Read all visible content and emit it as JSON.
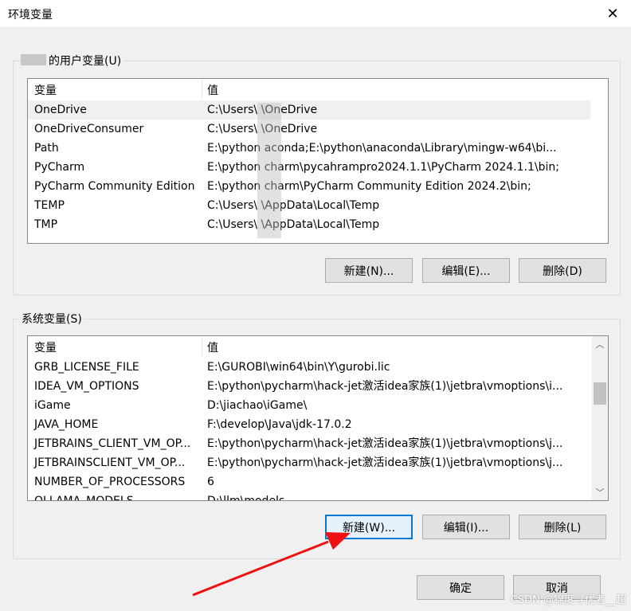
{
  "window": {
    "title": "环境变量",
    "close_glyph": "✕"
  },
  "user_vars": {
    "group_label": "的用户变量(U)",
    "header": {
      "name": "变量",
      "value": "值"
    },
    "rows": [
      {
        "name": "OneDrive",
        "value": "C:\\Users\\        \\OneDrive"
      },
      {
        "name": "OneDriveConsumer",
        "value": "C:\\Users\\        \\OneDrive"
      },
      {
        "name": "Path",
        "value": "E:\\python        aconda;E:\\python\\anaconda\\Library\\mingw-w64\\bi..."
      },
      {
        "name": "PyCharm",
        "value": "E:\\python        charm\\pycahrampro2024.1.1\\PyCharm 2024.1.1\\bin;"
      },
      {
        "name": "PyCharm Community Edition",
        "value": "E:\\python        charm\\PyCharm Community Edition 2024.2\\bin;"
      },
      {
        "name": "TEMP",
        "value": "C:\\Users\\        \\AppData\\Local\\Temp"
      },
      {
        "name": "TMP",
        "value": "C:\\Users\\        \\AppData\\Local\\Temp"
      }
    ],
    "buttons": {
      "new": "新建(N)...",
      "edit": "编辑(E)...",
      "delete": "删除(D)"
    }
  },
  "sys_vars": {
    "group_label": "系统变量(S)",
    "header": {
      "name": "变量",
      "value": "值"
    },
    "rows": [
      {
        "name": "GRB_LICENSE_FILE",
        "value": "E:\\GUROBI\\win64\\bin\\Y\\gurobi.lic"
      },
      {
        "name": "IDEA_VM_OPTIONS",
        "value": "E:\\python\\pycharm\\hack-jet激活idea家族(1)\\jetbra\\vmoptions\\i..."
      },
      {
        "name": "iGame",
        "value": "D:\\jiachao\\iGame\\"
      },
      {
        "name": "JAVA_HOME",
        "value": "F:\\develop\\Java\\jdk-17.0.2"
      },
      {
        "name": "JETBRAINS_CLIENT_VM_OP...",
        "value": "E:\\python\\pycharm\\hack-jet激活idea家族(1)\\jetbra\\vmoptions\\j..."
      },
      {
        "name": "JETBRAINSCLIENT_VM_OP...",
        "value": "E:\\python\\pycharm\\hack-jet激活idea家族(1)\\jetbra\\vmoptions\\j..."
      },
      {
        "name": "NUMBER_OF_PROCESSORS",
        "value": "6"
      },
      {
        "name": "OLLAMA_MODELS",
        "value": "D:\\llm\\models"
      }
    ],
    "buttons": {
      "new": "新建(W)...",
      "edit": "编辑(I)...",
      "delete": "删除(L)"
    }
  },
  "footer": {
    "ok": "确定",
    "cancel": "取消"
  },
  "watermark": "CSDN @锦度寻优者__超",
  "colors": {
    "annotation_arrow": "#ee1111",
    "focus": "#0078d7"
  }
}
